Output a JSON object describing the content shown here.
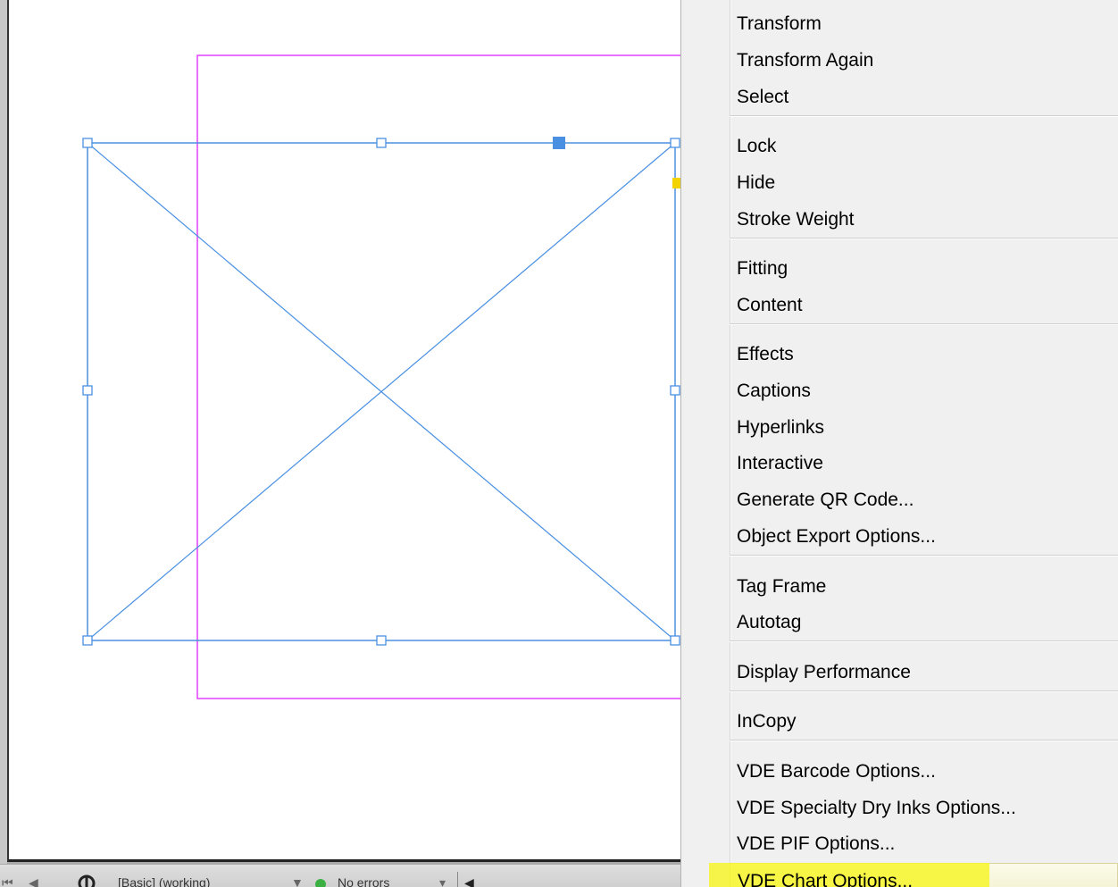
{
  "canvas": {
    "frame_stroke_color": "#4a90e2",
    "margin_color": "#e040fb",
    "handle_fill": "#ffffff",
    "selected_handle_fill": "#4a90e2",
    "anchor_color": "#f2d200"
  },
  "statusbar": {
    "nav_first_icon": "first-page-icon",
    "nav_prev_icon": "previous-page-icon",
    "preflight_icon": "preflight-profile-icon",
    "profile_label": "[Basic] (working)",
    "dropdown_icon": "dropdown-triangle-icon",
    "status_dot_color": "#3cb043",
    "status_text": "No errors",
    "menu_icon": "dropdown-triangle-icon",
    "scroll_left_icon": "scroll-left-icon"
  },
  "context_menu": {
    "items": [
      {
        "label": "Transform"
      },
      {
        "label": "Transform Again"
      },
      {
        "label": "Select"
      },
      {
        "label": "Lock"
      },
      {
        "label": "Hide"
      },
      {
        "label": "Stroke Weight"
      },
      {
        "label": "Fitting"
      },
      {
        "label": "Content"
      },
      {
        "label": "Effects"
      },
      {
        "label": "Captions"
      },
      {
        "label": "Hyperlinks"
      },
      {
        "label": "Interactive"
      },
      {
        "label": "Generate QR Code..."
      },
      {
        "label": "Object Export Options..."
      },
      {
        "label": "Tag Frame"
      },
      {
        "label": "Autotag"
      },
      {
        "label": "Display Performance"
      },
      {
        "label": "InCopy"
      },
      {
        "label": "VDE Barcode Options..."
      },
      {
        "label": "VDE Specialty Dry Inks Options..."
      },
      {
        "label": "VDE PIF Options..."
      },
      {
        "label": "VDE Chart Options...",
        "highlighted": true,
        "highlight_color": "#f7f42a"
      }
    ]
  }
}
